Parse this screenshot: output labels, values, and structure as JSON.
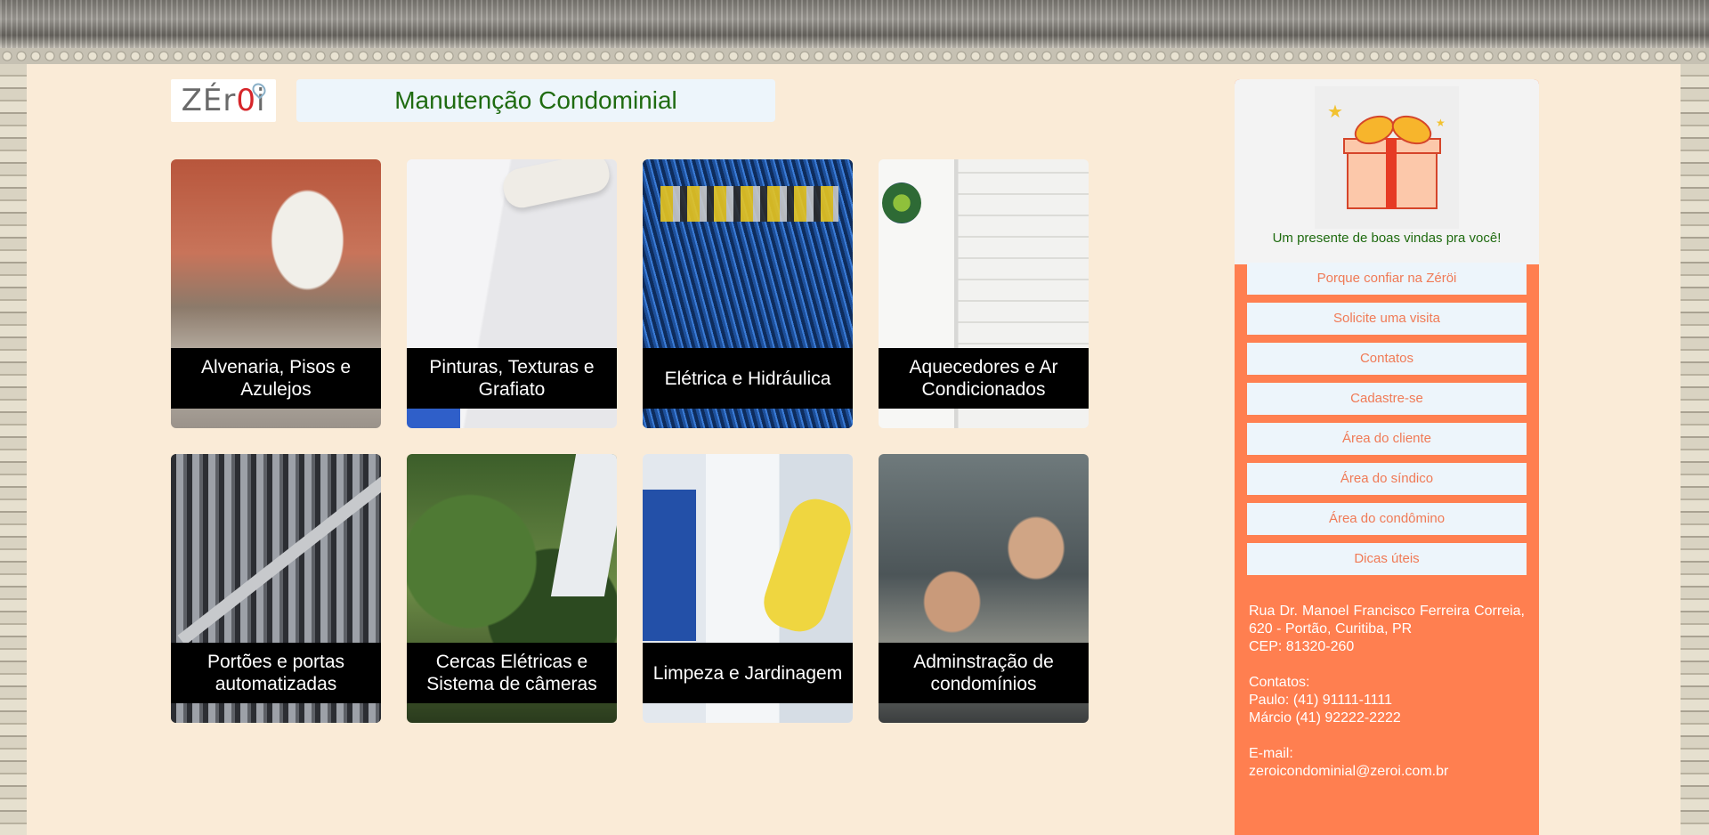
{
  "header": {
    "logo_text_before": "ZÉr",
    "logo_text_zero": "0",
    "logo_text_after": "i",
    "title": "Manutenção Condominial"
  },
  "services": [
    {
      "label": "Alvenaria, Pisos e Azulejos",
      "image": "masonry-photo"
    },
    {
      "label": "Pinturas, Texturas e Grafiato",
      "image": "paint-roller-photo"
    },
    {
      "label": "Elétrica e Hidráulica",
      "image": "electrical-panel-photo"
    },
    {
      "label": "Aquecedores e Ar Condicionados",
      "image": "water-heater-photo"
    },
    {
      "label": "Portões e portas automatizadas",
      "image": "gate-photo"
    },
    {
      "label": "Cercas Elétricas e Sistema de câmeras",
      "image": "electric-fence-photo"
    },
    {
      "label": "Limpeza e Jardinagem",
      "image": "cleaning-photo"
    },
    {
      "label": "Adminstração de condomínios",
      "image": "meeting-photo"
    }
  ],
  "sidebar": {
    "gift_text": "Um presente de boas vindas pra você!",
    "menu": [
      {
        "label": "Porque confiar na Zéröi"
      },
      {
        "label": "Solicite uma visita"
      },
      {
        "label": "Contatos"
      },
      {
        "label": "Cadastre-se"
      },
      {
        "label": "Área do cliente"
      },
      {
        "label": "Área do síndico"
      },
      {
        "label": "Área do condômino"
      },
      {
        "label": "Dicas úteis"
      }
    ],
    "address_line1": "Rua Dr. Manoel Francisco Ferreira Correia, 620 - Portão, Curitiba, PR",
    "cep": "CEP: 81320-260",
    "contacts_heading": "Contatos:",
    "contact1": "Paulo: (41) 91111-1111",
    "contact2": "Márcio (41) 92222-2222",
    "email_heading": "E-mail:",
    "email": "zeroicondominial@zeroi.com.br"
  },
  "colors": {
    "page_bg": "#faebd7",
    "sidebar_bg": "#ff7f50",
    "menu_item_bg": "#edf5fb",
    "menu_item_text": "#f07a56",
    "title_text": "#1f6b10"
  }
}
